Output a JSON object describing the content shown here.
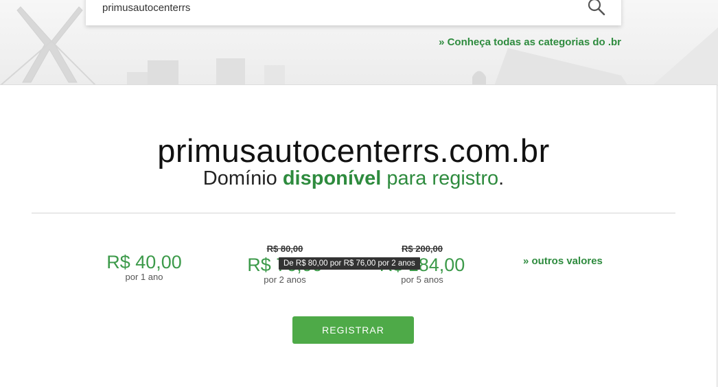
{
  "search": {
    "value": "primusautocenterrs"
  },
  "header": {
    "categories_link": "»  Conheça todas as categorias do .br"
  },
  "result": {
    "domain": "primusautocenterrs.com.br",
    "status_prefix": "Domínio ",
    "status_highlight": "disponível",
    "status_suffix": " para registro",
    "status_end": "."
  },
  "prices": [
    {
      "old": "",
      "amount": "R$ 40,00",
      "period": "por 1 ano"
    },
    {
      "old": "R$ 80,00",
      "amount": "R$ 76,00",
      "period": "por 2 anos"
    },
    {
      "old": "R$ 200,00",
      "amount": "R$ 184,00",
      "period": "por 5 anos"
    }
  ],
  "other_values": "» outros valores",
  "tooltip": "De R$ 80,00 por R$ 76,00 por 2 anos",
  "register_button": "REGISTRAR",
  "colors": {
    "accent_green": "#2e8b3e",
    "price_green": "#3c9a4a",
    "button_green": "#4eaa48"
  }
}
